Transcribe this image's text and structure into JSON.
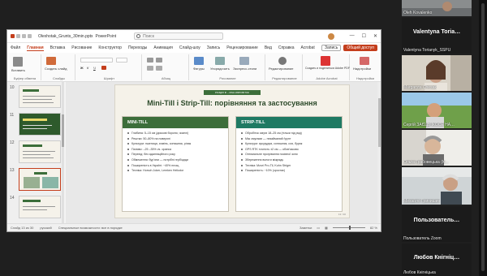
{
  "ppt": {
    "file_name": "Olexhotak_Grunts_30min.pptx",
    "app_name": "PowerPoint",
    "search_placeholder": "Поиск",
    "menu": [
      "Файл",
      "Главная",
      "Вставка",
      "Рисование",
      "Конструктор",
      "Переходы",
      "Анимация",
      "Слайд-шоу",
      "Запись",
      "Рецензирование",
      "Вид",
      "Справка",
      "Acrobat"
    ],
    "menu_active_index": 1,
    "record_label": "Запись",
    "share_label": "Общий доступ",
    "ribbon": {
      "groups": [
        "Буфер обмена",
        "Слайды",
        "Шрифт",
        "Абзац",
        "Рисование",
        "Редактирование",
        "Adobe Acrobat",
        "Надстройки"
      ],
      "items": [
        "Вставить",
        "Создать слайд",
        "Фигуры",
        "Упорядочить",
        "Экспресс-стили",
        "Диктовать",
        "Конструктор",
        "Редактирование",
        "Создать и поделиться Adobe PDF",
        "Надстройки"
      ]
    },
    "thumbnails": [
      {
        "num": "10"
      },
      {
        "num": "11"
      },
      {
        "num": "12"
      },
      {
        "num": "13"
      },
      {
        "num": "14"
      }
    ],
    "selected_thumb": 3,
    "slide": {
      "tag": "РОЗДІЛ III – МІНІ-ОБРОБІТОК",
      "title": "Mini-Till і Strip-Till: порівняння та застосування",
      "left": {
        "header": "MINI-TILL",
        "items": [
          "Глибина: 5–15 см (дискові борони, чизелі)",
          "Рештки: 50–80% на поверхні",
          "Культури: пшениця, ячмінь, соняшник, ріпак",
          "Паливо: –25 –35% vs. оранка",
          "Перехід: без адаптаційного року",
          "Обмеження: бур'яни — потрібні гербіциди",
          "Поширеність в Україні: ~40% площ",
          "Техніка: Horsch Joker, Lemken Heliodor"
        ]
      },
      "right": {
        "header": "STRIP-TILL",
        "items": [
          "Обробіток смуги 18–25 см (тільки під ряд)",
          "Між смугами — незайманий ґрунт",
          "Культури: кукурудза, соняшник, соя, буряк",
          "GPS RTK точність ±2 см — обов'язково",
          "Оптимальне прогрівання посівної зони",
          "Збереження вологи міжрядь",
          "Техніка: Mzuri Pro-Til, Kuhn Striger",
          "Поширеність: ~10% (зростає)"
        ]
      },
      "page_number": "13 / 30"
    },
    "status": {
      "slide_info": "Слайд 13 из 30",
      "language": "русский",
      "accessibility": "Специальные возможности: все в порядке",
      "notes": "Заметки",
      "zoom": "82 %"
    }
  },
  "participants": [
    {
      "name": "Oleh Kovalenko"
    },
    {
      "name": "Valentyna Toria…",
      "sub": "Valentyna Torianyk_SSPU"
    },
    {
      "name": "Margaryta Chesak"
    },
    {
      "name": "Сергій ЗАЄЦЬ ІКОСЕ НА…"
    },
    {
      "name": "Ольга Грабовецька (К…"
    },
    {
      "name": "Михайло Гринишин"
    },
    {
      "name": "Пользователь…",
      "sub": "Пользователь Zoom"
    },
    {
      "name": "Любов Кнігніц…",
      "sub": "Любов Кнігніцька"
    }
  ],
  "colors": {
    "accent": "#c43e1c",
    "slide_green": "#3c6e3a",
    "slide_teal": "#1e7a63"
  }
}
